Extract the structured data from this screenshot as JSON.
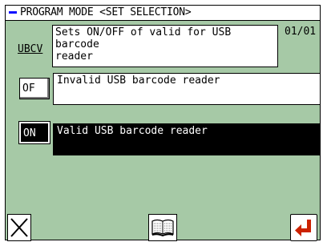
{
  "header": {
    "title": "PROGRAM MODE <SET SELECTION>"
  },
  "setting": {
    "code": "UBCV",
    "description": "Sets ON/OFF of valid for USB barcode\nreader",
    "page": "01/01"
  },
  "options": [
    {
      "code": "OF",
      "label": "Invalid USB barcode reader",
      "selected": false
    },
    {
      "code": "ON",
      "label": "Valid USB barcode reader",
      "selected": true
    }
  ],
  "footer": {
    "cancel_icon": "close-x-icon",
    "manual_icon": "book-icon",
    "enter_icon": "enter-return-icon"
  },
  "colors": {
    "background": "#a6c9a6",
    "accent_dash": "#1010ff",
    "enter_arrow": "#cc2200"
  }
}
